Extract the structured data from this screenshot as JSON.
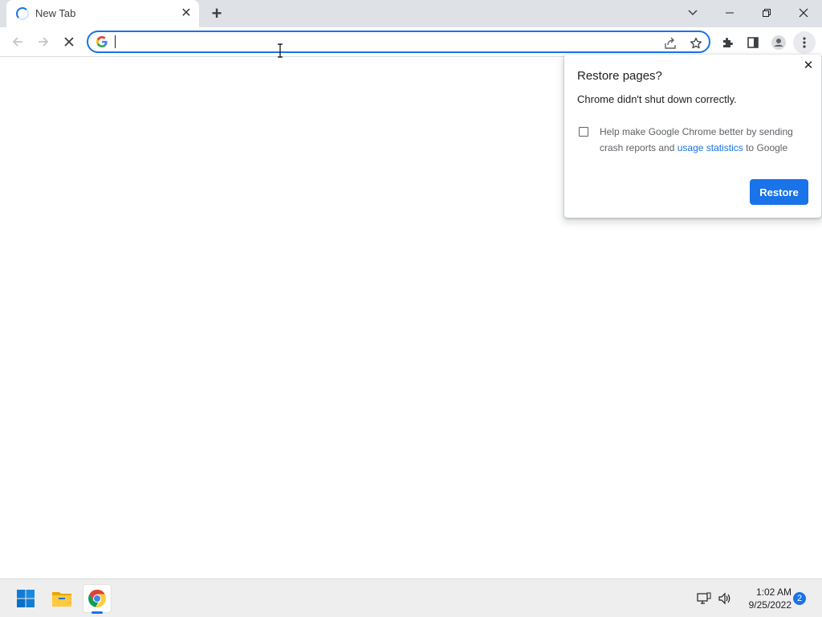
{
  "tab": {
    "title": "New Tab",
    "close_label": "✕",
    "new_tab_label": "+"
  },
  "omnibox": {
    "value": "",
    "placeholder": ""
  },
  "restore_bubble": {
    "title": "Restore pages?",
    "message": "Chrome didn't shut down correctly.",
    "checkbox_text_before": "Help make Google Chrome better by sending crash reports and ",
    "checkbox_link": "usage statistics",
    "checkbox_text_after": " to Google",
    "checkbox_checked": false,
    "close_label": "✕",
    "button_label": "Restore"
  },
  "taskbar": {
    "time": "1:02 AM",
    "date": "9/25/2022",
    "notification_count": "2",
    "pinned": [
      "start-icon",
      "file-explorer-icon",
      "chrome-icon"
    ]
  },
  "colors": {
    "accent": "#1a73e8",
    "tabstrip": "#dee1e6",
    "taskbar": "#eeeeef"
  }
}
